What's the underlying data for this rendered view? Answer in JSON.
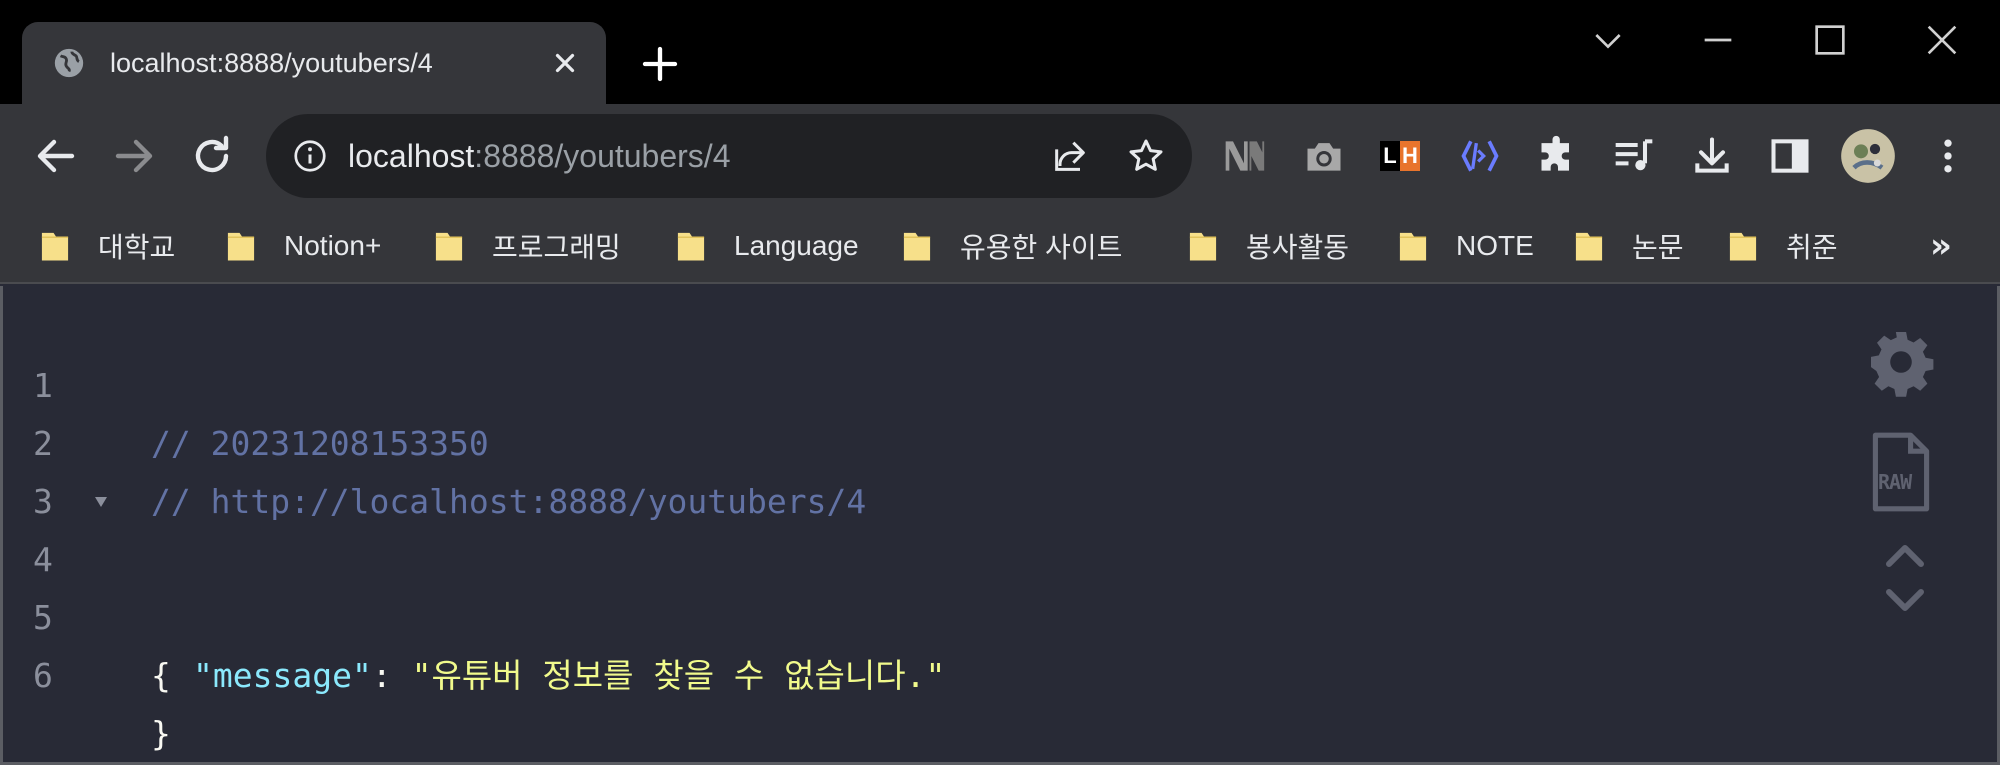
{
  "tab": {
    "title": "localhost:8888/youtubers/4"
  },
  "omnibox": {
    "host": "localhost",
    "rest": ":8888/youtubers/4"
  },
  "bookmarks": [
    {
      "label": "대학교"
    },
    {
      "label": "Notion+"
    },
    {
      "label": "프로그래밍"
    },
    {
      "label": "Language"
    },
    {
      "label": "유용한 사이트"
    },
    {
      "label": "봉사활동"
    },
    {
      "label": "NOTE"
    },
    {
      "label": "논문"
    },
    {
      "label": "취준"
    }
  ],
  "bookmarks_more": "»",
  "extensions": {
    "lh_left": "L",
    "lh_right": "H"
  },
  "json_view": {
    "lines": [
      {
        "num": "1",
        "comment": "// 20231208153350"
      },
      {
        "num": "2",
        "comment": "// http://localhost:8888/youtubers/4"
      },
      {
        "num": "3"
      },
      {
        "num": "4",
        "open": "{"
      },
      {
        "num": "5",
        "key": "message",
        "value": "유튜버 정보를 찾을 수 없습니다."
      },
      {
        "num": "6",
        "close": "}"
      }
    ],
    "raw_label": "RAW"
  },
  "colors": {
    "background": "#282a36",
    "comment": "#6272a4",
    "key": "#8be9fd",
    "string": "#f1fa8c",
    "chrome_toolbar": "#35363a"
  }
}
